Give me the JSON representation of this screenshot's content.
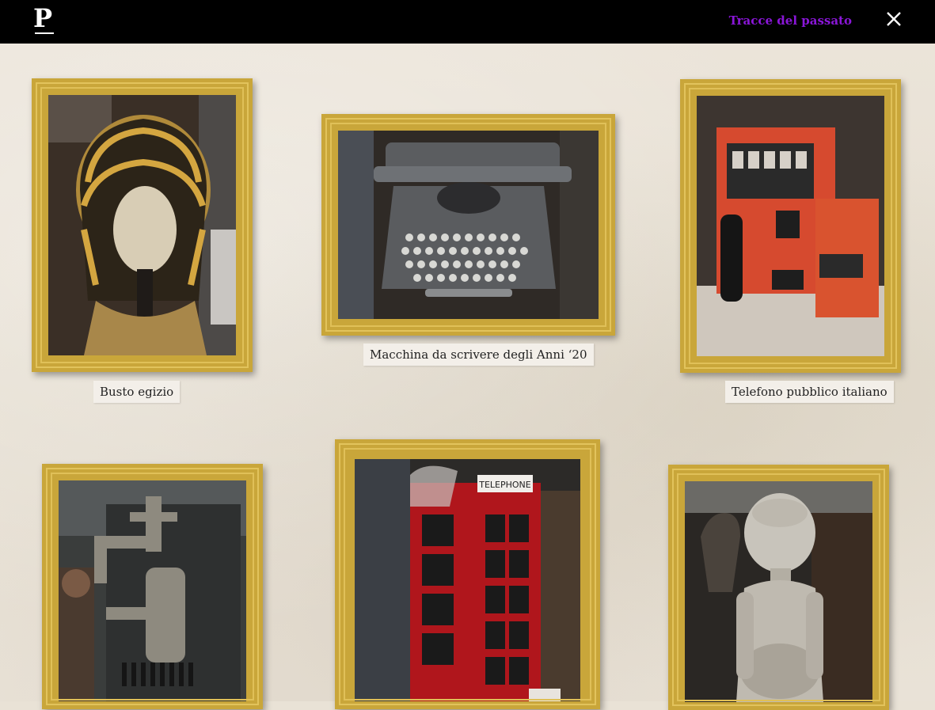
{
  "header": {
    "logo_letter": "P",
    "section_title": "Tracce del passato",
    "close_icon": "close-icon"
  },
  "gallery": {
    "items": [
      {
        "caption": "Busto egizio",
        "subject": "egyptian-bust"
      },
      {
        "caption": "Macchina da scrivere degli Anni ‘20",
        "subject": "typewriter"
      },
      {
        "caption": "Telefono pubblico italiano",
        "subject": "payphone"
      },
      {
        "caption": "",
        "subject": "vintage-faucets"
      },
      {
        "caption": "",
        "subject": "red-telephone-box"
      },
      {
        "caption": "",
        "subject": "wooden-statue"
      }
    ]
  },
  "colors": {
    "frame_gold": "#c9a63a",
    "accent_purple": "#8a16d8",
    "topbar": "#000000",
    "wall": "#e9e2d6"
  }
}
